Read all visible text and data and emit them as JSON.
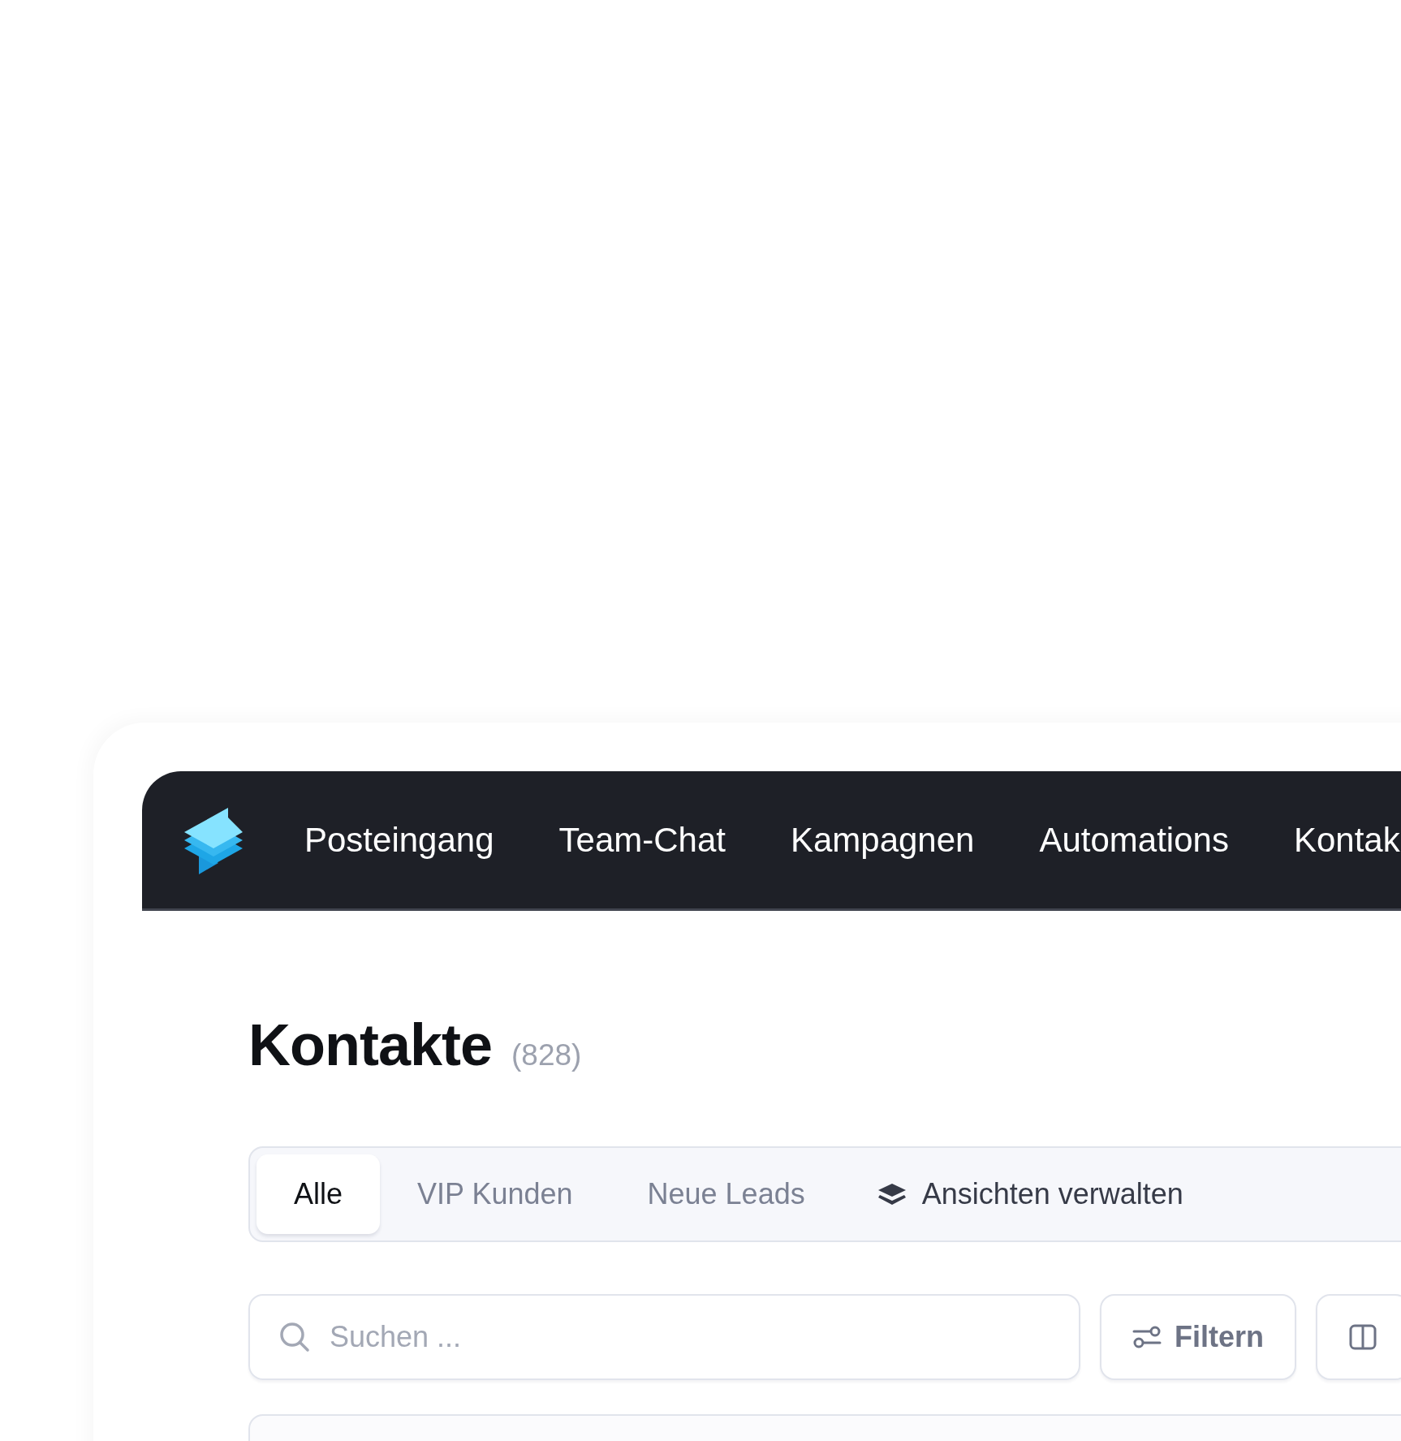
{
  "nav": {
    "items": [
      {
        "label": "Posteingang"
      },
      {
        "label": "Team-Chat"
      },
      {
        "label": "Kampagnen"
      },
      {
        "label": "Automations"
      },
      {
        "label": "Kontak"
      }
    ]
  },
  "page": {
    "title": "Kontakte",
    "count": "(828)"
  },
  "tabs": [
    {
      "label": "Alle",
      "selected": true
    },
    {
      "label": "VIP Kunden",
      "selected": false
    },
    {
      "label": "Neue Leads",
      "selected": false
    }
  ],
  "manage_views": {
    "label": "Ansichten verwalten"
  },
  "search": {
    "placeholder": "Suchen ..."
  },
  "toolbar_buttons": [
    {
      "label": "Filtern",
      "kind": "filter"
    },
    {
      "kind": "columns"
    }
  ]
}
